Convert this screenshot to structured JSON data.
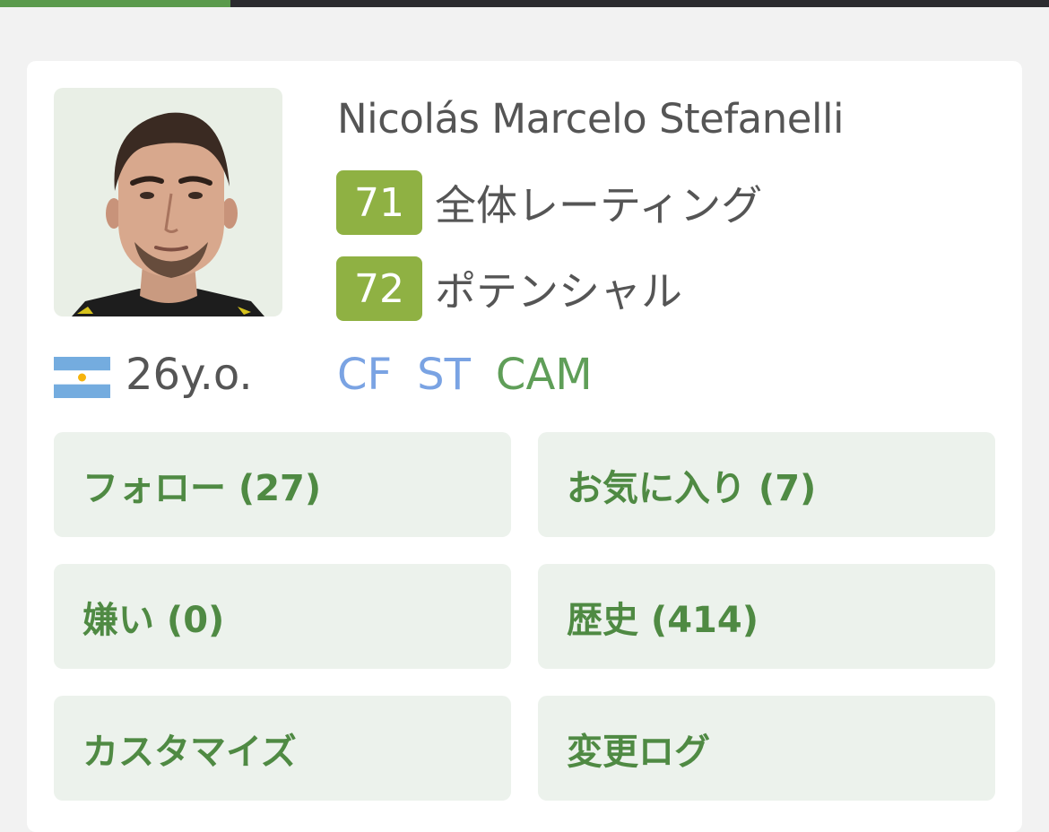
{
  "page_progress": 0.22,
  "player": {
    "name": "Nicolás Marcelo Stefanelli",
    "age": "26y.o.",
    "flag": "argentina-flag",
    "overall": {
      "value": "71",
      "label": "全体レーティング"
    },
    "potential": {
      "value": "72",
      "label": "ポテンシャル"
    },
    "positions": [
      {
        "code": "CF",
        "color": "#7aa3e3"
      },
      {
        "code": "ST",
        "color": "#7aa3e3"
      },
      {
        "code": "CAM",
        "color": "#5f9e58"
      }
    ]
  },
  "actions": [
    {
      "label": "フォロー (27)"
    },
    {
      "label": "お気に入り (7)"
    },
    {
      "label": "嫌い (0)"
    },
    {
      "label": "歴史 (414)"
    },
    {
      "label": "カスタマイズ"
    },
    {
      "label": "変更ログ"
    }
  ],
  "colors": {
    "rating_badge": "#8fb143",
    "tile_bg": "#ecf2ec",
    "tile_text": "#4f8a43",
    "accent": "#5a9a4c"
  }
}
